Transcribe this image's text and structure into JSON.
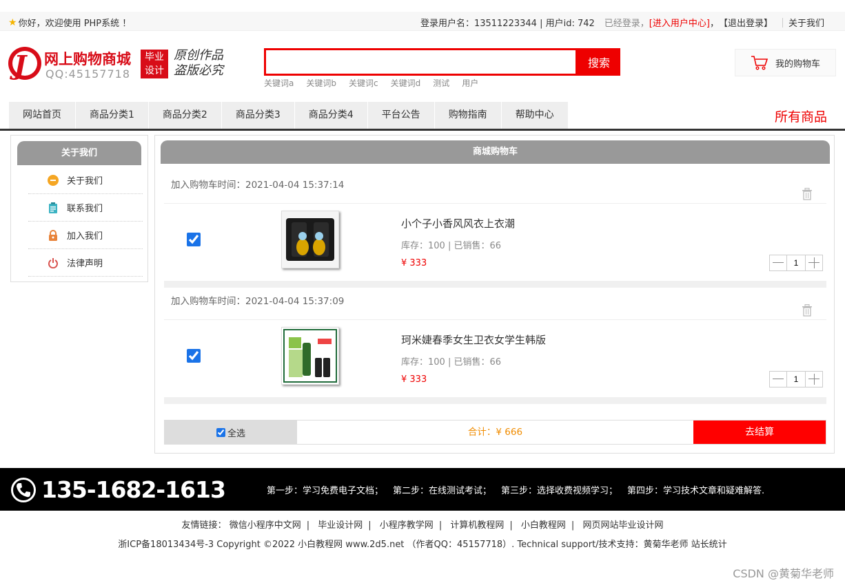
{
  "topbar": {
    "welcome": "你好，欢迎使用 PHP系统 ！",
    "user_info": "登录用户名：13511223344 | 用户id: 742",
    "logged_in": "已经登录，",
    "user_center": "[进入用户中心]",
    "comma": "，",
    "logout": "【退出登录】",
    "about": "关于我们"
  },
  "logo": {
    "name": "网上购物商城",
    "qq": "QQ:45157718",
    "badge_line1": "毕业",
    "badge_line2": "设计",
    "slogan_line1": "原创作品",
    "slogan_line2": "盗版必究"
  },
  "search": {
    "placeholder": "",
    "button": "搜索",
    "hotwords": [
      "关键词a",
      "关键词b",
      "关键词c",
      "关键词d",
      "测试",
      "用户"
    ]
  },
  "cart_button": "我的购物车",
  "nav": {
    "items": [
      "网站首页",
      "商品分类1",
      "商品分类2",
      "商品分类3",
      "商品分类4",
      "平台公告",
      "购物指南",
      "帮助中心"
    ],
    "all_goods": "所有商品"
  },
  "sidebar": {
    "title": "关于我们",
    "items": [
      {
        "label": "关于我们",
        "icon": "info-icon",
        "color": "#f5a623"
      },
      {
        "label": "联系我们",
        "icon": "clipboard-icon",
        "color": "#3bb3c3"
      },
      {
        "label": "加入我们",
        "icon": "lock-icon",
        "color": "#e8833a"
      },
      {
        "label": "法律声明",
        "icon": "power-icon",
        "color": "#d9534f"
      }
    ]
  },
  "cart": {
    "title": "商城购物车",
    "items": [
      {
        "added": "加入购物车时间：2021-04-04 15:37:14",
        "name": "小个子小香风风衣上衣潮",
        "stock": "库存：100 | 已销售：66",
        "price": "¥ 333",
        "qty": "1",
        "checked": true
      },
      {
        "added": "加入购物车时间：2021-04-04 15:37:09",
        "name": "珂米婕春季女生卫衣女学生韩版",
        "stock": "库存：100 | 已销售：66",
        "price": "¥ 333",
        "qty": "1",
        "checked": true
      }
    ],
    "select_all": "全选",
    "total": "合计：¥ 666",
    "checkout": "去结算"
  },
  "footer": {
    "phone": "135-1682-1613",
    "steps": [
      "第一步：学习免费电子文档；",
      "第二步：在线测试考试；",
      "第三步：选择收费视频学习；",
      "第四步：学习技术文章和疑难解答."
    ],
    "links_label": "友情链接：",
    "links": [
      "微信小程序中文网",
      "毕业设计网",
      "小程序教学网",
      "计算机教程网",
      "小白教程网",
      "网页网站毕业设计网"
    ],
    "copyright": "浙ICP备18013434号-3 Copyright ©2022 小白教程网 www.2d5.net （作者QQ：45157718）. Technical support/技术支持：黄菊华老师 站长统计"
  },
  "watermark": "CSDN @黄菊华老师",
  "colors": {
    "accent": "#ee0000",
    "header_gray": "#999999",
    "total_orange": "#f08c00"
  }
}
